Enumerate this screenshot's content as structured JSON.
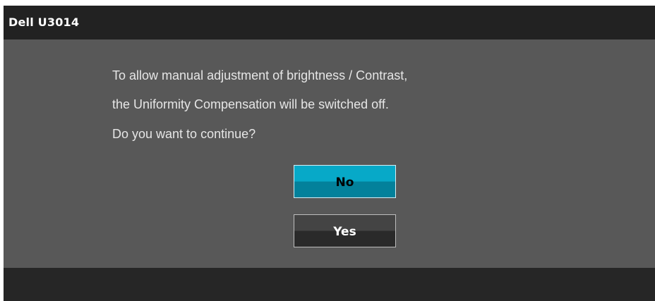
{
  "window": {
    "title": "Dell U3014"
  },
  "dialog": {
    "message_lines": [
      "To allow manual adjustment of brightness / Contrast,",
      "the Uniformity Compensation will be switched off.",
      "Do you want to continue?"
    ],
    "buttons": {
      "no_label": "No",
      "yes_label": "Yes"
    }
  },
  "colors": {
    "title_bar": "#222222",
    "panel": "#585858",
    "selected_button": "#07a9c8",
    "unselected_button": "#333333"
  }
}
